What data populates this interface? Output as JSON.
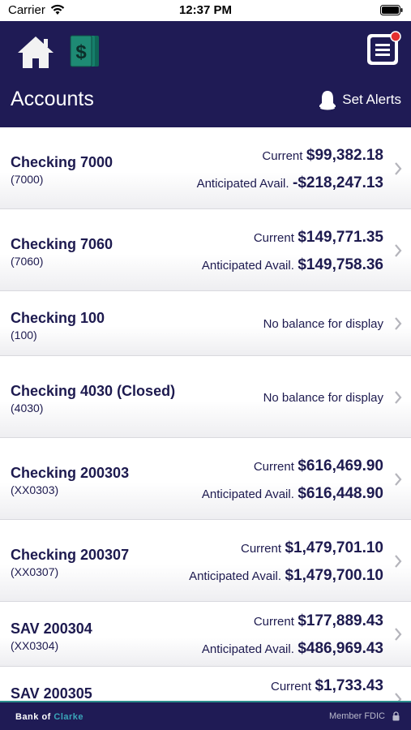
{
  "status_bar": {
    "carrier": "Carrier",
    "time": "12:37 PM"
  },
  "header": {
    "title": "Accounts",
    "set_alerts_label": "Set Alerts"
  },
  "accounts": [
    {
      "name": "Checking 7000",
      "number": "(7000)",
      "current_label": "Current",
      "current_value": "$99,382.18",
      "avail_label": "Anticipated Avail.",
      "avail_value": "-$218,247.13"
    },
    {
      "name": "Checking 7060",
      "number": "(7060)",
      "current_label": "Current",
      "current_value": "$149,771.35",
      "avail_label": "Anticipated Avail.",
      "avail_value": "$149,758.36"
    },
    {
      "name": "Checking 100",
      "number": "(100)",
      "no_balance": "No balance for display"
    },
    {
      "name": "Checking 4030 (Closed)",
      "number": "(4030)",
      "no_balance": "No balance for display"
    },
    {
      "name": "Checking 200303",
      "number": "(XX0303)",
      "current_label": "Current",
      "current_value": "$616,469.90",
      "avail_label": "Anticipated Avail.",
      "avail_value": "$616,448.90"
    },
    {
      "name": "Checking 200307",
      "number": "(XX0307)",
      "current_label": "Current",
      "current_value": "$1,479,701.10",
      "avail_label": "Anticipated Avail.",
      "avail_value": "$1,479,700.10"
    },
    {
      "name": "SAV 200304",
      "number": "(XX0304)",
      "current_label": "Current",
      "current_value": "$177,889.43",
      "avail_label": "Anticipated Avail.",
      "avail_value": "$486,969.43"
    },
    {
      "name": "SAV 200305",
      "number": "",
      "current_label": "Current",
      "current_value": "$1,733.43"
    }
  ],
  "footer": {
    "bank_name_part1": "Bank of ",
    "bank_name_part2": "Clarke",
    "fdic": "Member FDIC"
  },
  "colors": {
    "header_bg": "#1f1b55",
    "text": "#1d1a4f",
    "dollar_icon": "#1e8a74",
    "notification_dot": "#e5302f",
    "footer_accent": "#3aa6b9"
  },
  "icons": [
    "wifi-icon",
    "battery-icon",
    "home-icon",
    "dollar-icon",
    "menu-icon",
    "bell-icon",
    "chevron-right-icon",
    "lock-icon"
  ]
}
